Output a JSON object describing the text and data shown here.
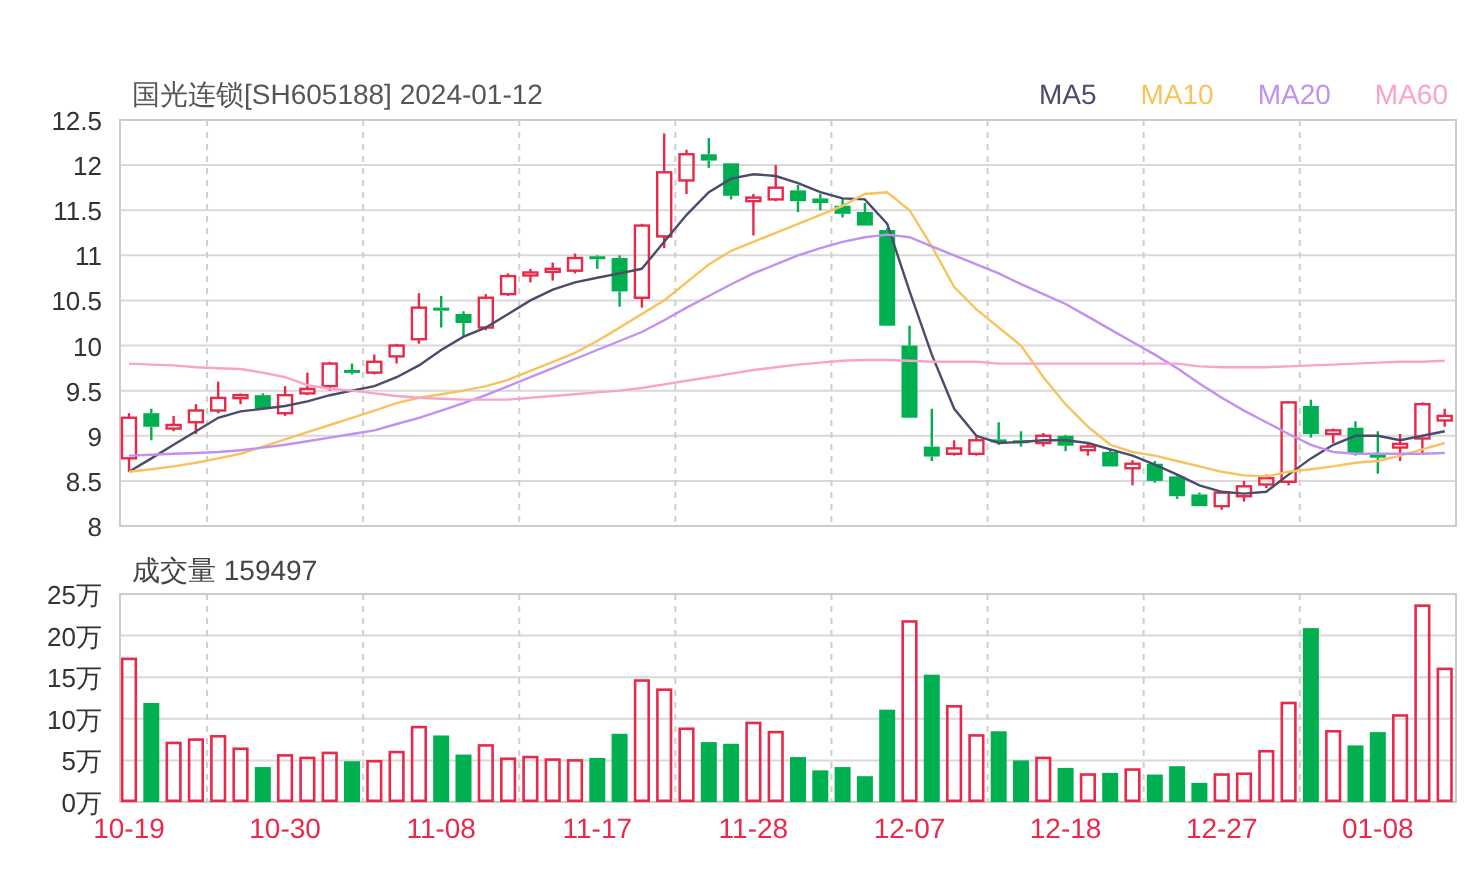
{
  "title": "国光连锁[SH605188] 2024-01-12",
  "price_chart": {
    "chart_data": {
      "type": "candlestick",
      "grid": true,
      "ylim": [
        8,
        12.5
      ],
      "yticks": [
        8,
        8.5,
        9,
        9.5,
        10,
        10.5,
        11,
        11.5,
        12,
        12.5
      ],
      "series": [
        {
          "name": "MA5",
          "type": "line",
          "color": "#4b4b6b",
          "values": [
            8.6,
            8.75,
            8.9,
            9.05,
            9.2,
            9.27,
            9.3,
            9.33,
            9.38,
            9.45,
            9.5,
            9.55,
            9.65,
            9.78,
            9.95,
            10.1,
            10.2,
            10.35,
            10.5,
            10.62,
            10.7,
            10.75,
            10.8,
            10.85,
            11.15,
            11.45,
            11.7,
            11.85,
            11.9,
            11.88,
            11.8,
            11.7,
            11.63,
            11.62,
            11.35,
            10.6,
            9.9,
            9.3,
            9.0,
            8.92,
            8.93,
            8.95,
            8.95,
            8.92,
            8.85,
            8.78,
            8.68,
            8.57,
            8.45,
            8.38,
            8.36,
            8.38,
            8.57,
            8.75,
            8.9,
            9.0,
            9.0,
            8.95,
            9.0,
            9.05
          ]
        },
        {
          "name": "MA10",
          "type": "line",
          "color": "#f8c35f",
          "values": [
            8.6,
            8.63,
            8.66,
            8.7,
            8.75,
            8.8,
            8.88,
            8.96,
            9.04,
            9.12,
            9.2,
            9.28,
            9.36,
            9.42,
            9.46,
            9.5,
            9.55,
            9.62,
            9.72,
            9.82,
            9.92,
            10.05,
            10.2,
            10.35,
            10.5,
            10.7,
            10.9,
            11.05,
            11.15,
            11.25,
            11.35,
            11.45,
            11.55,
            11.68,
            11.7,
            11.5,
            11.1,
            10.65,
            10.4,
            10.2,
            10.0,
            9.65,
            9.35,
            9.1,
            8.9,
            8.82,
            8.78,
            8.72,
            8.66,
            8.6,
            8.56,
            8.55,
            8.6,
            8.63,
            8.66,
            8.7,
            8.72,
            8.78,
            8.85,
            8.92
          ]
        },
        {
          "name": "MA20",
          "type": "line",
          "color": "#c291ef",
          "values": [
            8.78,
            8.79,
            8.8,
            8.81,
            8.82,
            8.84,
            8.87,
            8.9,
            8.94,
            8.98,
            9.02,
            9.06,
            9.13,
            9.2,
            9.28,
            9.36,
            9.45,
            9.55,
            9.65,
            9.75,
            9.85,
            9.95,
            10.05,
            10.15,
            10.28,
            10.42,
            10.55,
            10.68,
            10.8,
            10.9,
            11.0,
            11.08,
            11.15,
            11.2,
            11.23,
            11.2,
            11.1,
            11.0,
            10.9,
            10.8,
            10.68,
            10.57,
            10.46,
            10.32,
            10.18,
            10.04,
            9.9,
            9.75,
            9.58,
            9.42,
            9.28,
            9.15,
            9.02,
            8.9,
            8.82,
            8.8,
            8.8,
            8.8,
            8.8,
            8.81
          ]
        },
        {
          "name": "MA60",
          "type": "line",
          "color": "#f9a3cb",
          "values": [
            9.8,
            9.79,
            9.78,
            9.76,
            9.75,
            9.74,
            9.7,
            9.65,
            9.56,
            9.52,
            9.5,
            9.47,
            9.44,
            9.42,
            9.41,
            9.4,
            9.4,
            9.4,
            9.42,
            9.44,
            9.46,
            9.48,
            9.5,
            9.53,
            9.57,
            9.61,
            9.65,
            9.69,
            9.73,
            9.76,
            9.79,
            9.81,
            9.83,
            9.84,
            9.84,
            9.83,
            9.82,
            9.82,
            9.82,
            9.8,
            9.8,
            9.8,
            9.8,
            9.8,
            9.8,
            9.8,
            9.8,
            9.8,
            9.77,
            9.76,
            9.76,
            9.76,
            9.77,
            9.78,
            9.79,
            9.8,
            9.81,
            9.82,
            9.82,
            9.83
          ]
        }
      ],
      "ohlc": [
        [
          8.75,
          9.25,
          8.6,
          9.2
        ],
        [
          9.25,
          9.3,
          8.95,
          9.1
        ],
        [
          9.08,
          9.22,
          9.05,
          9.12
        ],
        [
          9.15,
          9.35,
          9.02,
          9.28
        ],
        [
          9.28,
          9.6,
          9.25,
          9.42
        ],
        [
          9.42,
          9.47,
          9.35,
          9.45
        ],
        [
          9.45,
          9.47,
          9.3,
          9.3
        ],
        [
          9.25,
          9.55,
          9.22,
          9.45
        ],
        [
          9.47,
          9.7,
          9.45,
          9.52
        ],
        [
          9.55,
          9.82,
          9.5,
          9.8
        ],
        [
          9.73,
          9.8,
          9.68,
          9.7
        ],
        [
          9.7,
          9.9,
          9.68,
          9.82
        ],
        [
          9.88,
          10.02,
          9.8,
          10.0
        ],
        [
          10.07,
          10.58,
          10.02,
          10.42
        ],
        [
          10.42,
          10.55,
          10.2,
          10.4
        ],
        [
          10.35,
          10.38,
          10.1,
          10.25
        ],
        [
          10.2,
          10.57,
          10.17,
          10.53
        ],
        [
          10.57,
          10.8,
          10.55,
          10.77
        ],
        [
          10.79,
          10.85,
          10.7,
          10.81
        ],
        [
          10.82,
          10.92,
          10.72,
          10.85
        ],
        [
          10.83,
          11.02,
          10.8,
          10.97
        ],
        [
          10.99,
          11.0,
          10.85,
          10.97
        ],
        [
          10.97,
          11.0,
          10.43,
          10.6
        ],
        [
          10.53,
          11.35,
          10.42,
          11.33
        ],
        [
          11.21,
          12.35,
          11.08,
          11.92
        ],
        [
          11.83,
          12.17,
          11.68,
          12.12
        ],
        [
          12.12,
          12.3,
          11.97,
          12.05
        ],
        [
          12.02,
          12.02,
          11.62,
          11.66
        ],
        [
          11.6,
          11.68,
          11.22,
          11.64
        ],
        [
          11.62,
          12.0,
          11.6,
          11.75
        ],
        [
          11.72,
          11.78,
          11.48,
          11.6
        ],
        [
          11.63,
          11.68,
          11.5,
          11.58
        ],
        [
          11.55,
          11.63,
          11.42,
          11.46
        ],
        [
          11.48,
          11.58,
          11.33,
          11.33
        ],
        [
          11.28,
          11.3,
          10.22,
          10.22
        ],
        [
          10.0,
          10.22,
          9.2,
          9.2
        ],
        [
          8.88,
          9.3,
          8.72,
          8.77
        ],
        [
          8.8,
          8.95,
          8.78,
          8.86
        ],
        [
          8.8,
          9.0,
          8.78,
          8.95
        ],
        [
          8.96,
          9.15,
          8.9,
          8.93
        ],
        [
          8.95,
          9.05,
          8.88,
          8.92
        ],
        [
          8.92,
          9.03,
          8.88,
          9.0
        ],
        [
          9.0,
          9.01,
          8.83,
          8.89
        ],
        [
          8.84,
          8.92,
          8.78,
          8.88
        ],
        [
          8.82,
          8.85,
          8.66,
          8.66
        ],
        [
          8.64,
          8.73,
          8.45,
          8.69
        ],
        [
          8.69,
          8.72,
          8.48,
          8.5
        ],
        [
          8.55,
          8.57,
          8.3,
          8.33
        ],
        [
          8.35,
          8.37,
          8.22,
          8.22
        ],
        [
          8.22,
          8.38,
          8.18,
          8.37
        ],
        [
          8.33,
          8.5,
          8.27,
          8.44
        ],
        [
          8.46,
          8.57,
          8.42,
          8.53
        ],
        [
          8.49,
          9.38,
          8.45,
          9.37
        ],
        [
          9.33,
          9.4,
          8.98,
          9.02
        ],
        [
          9.02,
          9.08,
          8.92,
          9.06
        ],
        [
          9.09,
          9.16,
          8.78,
          8.8
        ],
        [
          8.79,
          9.05,
          8.58,
          8.76
        ],
        [
          8.87,
          9.02,
          8.72,
          8.91
        ],
        [
          8.97,
          9.37,
          8.8,
          9.35
        ],
        [
          9.17,
          9.3,
          9.1,
          9.22
        ]
      ]
    }
  },
  "volume_chart": {
    "title": "成交量 159497",
    "chart_data": {
      "type": "bar",
      "grid": true,
      "ylim": [
        0,
        25
      ],
      "categories": [
        "10-19",
        null,
        null,
        null,
        null,
        null,
        null,
        "10-30",
        null,
        null,
        null,
        null,
        null,
        null,
        "11-08",
        null,
        null,
        null,
        null,
        null,
        null,
        "11-17",
        null,
        null,
        null,
        null,
        null,
        null,
        "11-28",
        null,
        null,
        null,
        null,
        null,
        null,
        "12-07",
        null,
        null,
        null,
        null,
        null,
        null,
        "12-18",
        null,
        null,
        null,
        null,
        null,
        null,
        "12-27",
        null,
        null,
        null,
        null,
        null,
        null,
        "01-08",
        null,
        null,
        null
      ],
      "yticks": [
        {
          "value": 0,
          "label": "0万"
        },
        {
          "value": 5,
          "label": "5万"
        },
        {
          "value": 10,
          "label": "10万"
        },
        {
          "value": 15,
          "label": "15万"
        },
        {
          "value": 20,
          "label": "20万"
        },
        {
          "value": 25,
          "label": "25万"
        }
      ],
      "series": [
        {
          "color": "#e8294a",
          "values": [
            17.2,
            null,
            7.1,
            7.5,
            7.9,
            6.4,
            null,
            5.6,
            5.3,
            5.9,
            null,
            4.9,
            6.0,
            9.0,
            null,
            null,
            6.8,
            5.2,
            5.4,
            5.1,
            5.0,
            null,
            null,
            14.6,
            13.5,
            8.8,
            null,
            null,
            9.5,
            8.4,
            null,
            null,
            null,
            null,
            null,
            21.7,
            null,
            11.5,
            8.0,
            null,
            null,
            5.3,
            null,
            3.3,
            null,
            3.9,
            null,
            null,
            null,
            3.3,
            3.4,
            6.1,
            11.9,
            null,
            8.5,
            null,
            null,
            10.4,
            23.6,
            16.0
          ]
        },
        {
          "color": "#00b050",
          "values": [
            null,
            11.9,
            null,
            null,
            null,
            null,
            4.2,
            null,
            null,
            null,
            4.9,
            null,
            null,
            null,
            8.0,
            5.7,
            null,
            null,
            null,
            null,
            null,
            5.3,
            8.2,
            null,
            null,
            null,
            7.2,
            7.0,
            null,
            null,
            5.4,
            3.8,
            4.2,
            3.1,
            11.1,
            null,
            15.3,
            null,
            null,
            8.5,
            5.0,
            null,
            4.1,
            null,
            3.5,
            null,
            3.3,
            4.3,
            2.3,
            null,
            null,
            null,
            null,
            20.9,
            null,
            6.8,
            8.4,
            null,
            null,
            null
          ]
        }
      ]
    }
  }
}
